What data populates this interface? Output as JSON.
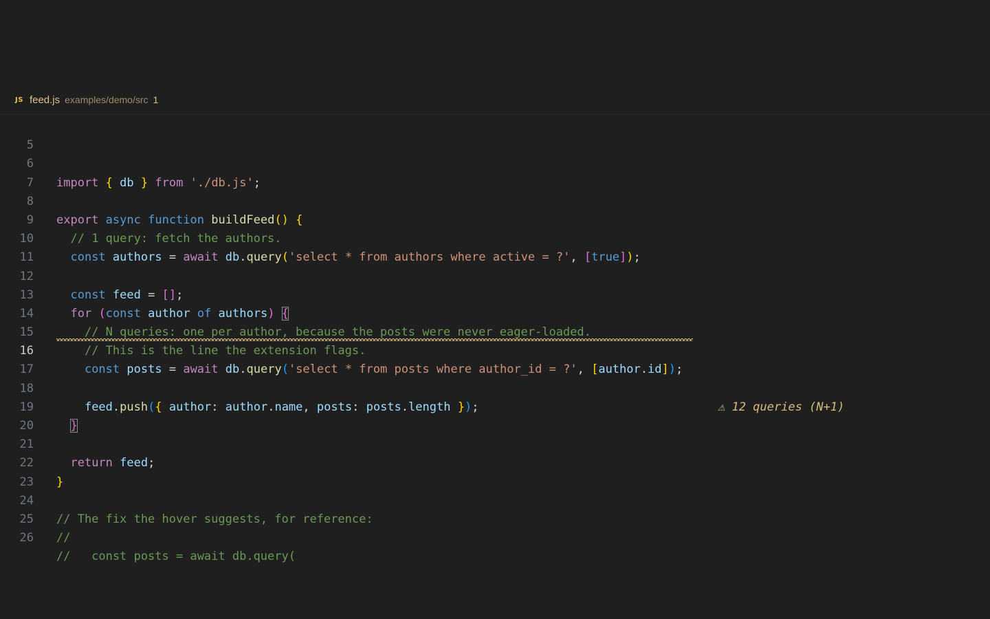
{
  "tab": {
    "icon_label": "JS",
    "file_name": "feed.js",
    "path": "examples/demo/src",
    "problem_count": "1"
  },
  "gutter": {
    "line_numbers": [
      "5",
      "6",
      "7",
      "8",
      "9",
      "10",
      "11",
      "12",
      "13",
      "14",
      "15",
      "16",
      "17",
      "18",
      "19",
      "20",
      "21",
      "22",
      "23",
      "24",
      "25",
      "26"
    ],
    "active_line": "16"
  },
  "code": {
    "l6": [
      "import",
      "{",
      "db",
      "}",
      "from",
      "'./db.js'",
      ";"
    ],
    "l8": [
      "export",
      "async",
      "function",
      "buildFeed",
      "()",
      "{"
    ],
    "l9": "// 1 query: fetch the authors.",
    "l10": [
      "const",
      "authors",
      "=",
      "await",
      "db",
      ".",
      "query",
      "(",
      "'select * from authors where active = ?'",
      ",",
      "[",
      "true",
      "]",
      ")",
      ";"
    ],
    "l12": [
      "const",
      "feed",
      "=",
      "[]",
      ";"
    ],
    "l13": [
      "for",
      "(",
      "const",
      "author",
      "of",
      "authors",
      ")",
      "{"
    ],
    "l14": "// N queries: one per author, because the posts were never eager-loaded.",
    "l15": "// This is the line the extension flags.",
    "l16": [
      "const",
      "posts",
      "=",
      "await",
      "db",
      ".",
      "query",
      "(",
      "'select * from posts where author_id = ?'",
      ",",
      "[",
      "author",
      ".",
      "id",
      "]",
      ")",
      ";"
    ],
    "l18": [
      "feed",
      ".",
      "push",
      "(",
      "{",
      "author",
      ":",
      "author",
      ".",
      "name",
      ",",
      "posts",
      ":",
      "posts",
      ".",
      "length",
      "}",
      ")",
      ";"
    ],
    "l19": "}",
    "l21": [
      "return",
      "feed",
      ";"
    ],
    "l22": "}",
    "l24": "// The fix the hover suggests, for reference:",
    "l25": "//",
    "l26": "//   const posts = await db.query("
  },
  "diagnostic": {
    "inlay_text": "⚠ 12 queries (N+1)",
    "severity": "warning",
    "color": "#d7ba7d"
  },
  "colors": {
    "background": "#1f1f1f",
    "keyword": "#c586c0",
    "storage": "#569cd6",
    "function": "#dcdcaa",
    "variable": "#9cdcfe",
    "string": "#ce9178",
    "comment": "#6a9955"
  }
}
